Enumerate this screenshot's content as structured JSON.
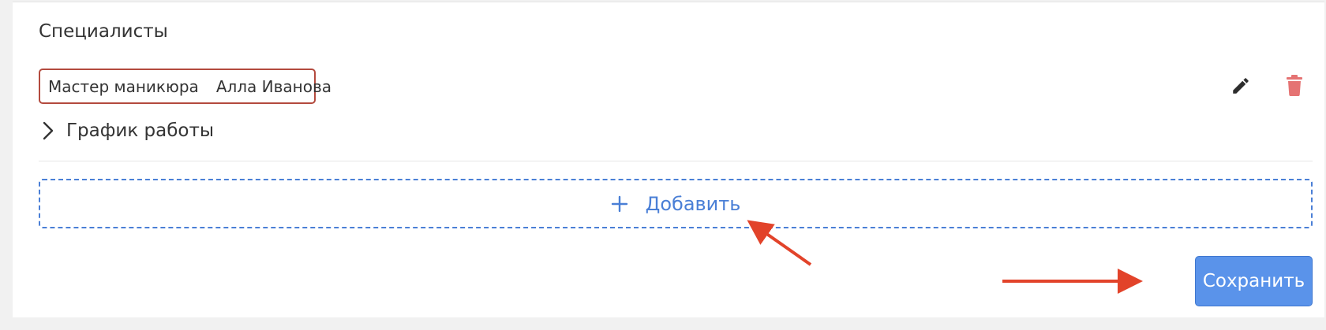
{
  "section": {
    "title": "Специалисты"
  },
  "specialist": {
    "role": "Мастер маникюра",
    "name": "Алла Иванова",
    "edit_icon": "pencil-icon",
    "delete_icon": "trash-icon"
  },
  "schedule": {
    "label": "График работы",
    "icon": "chevron-right-icon"
  },
  "add_button": {
    "label": "Добавить",
    "icon": "plus-icon"
  },
  "save_button": {
    "label": "Сохранить"
  },
  "colors": {
    "accent": "#4a7fd6",
    "save_bg": "#5a93ea",
    "delete": "#e57373",
    "highlight_border": "#b34a3e",
    "annotation_arrow": "#e2432a"
  }
}
